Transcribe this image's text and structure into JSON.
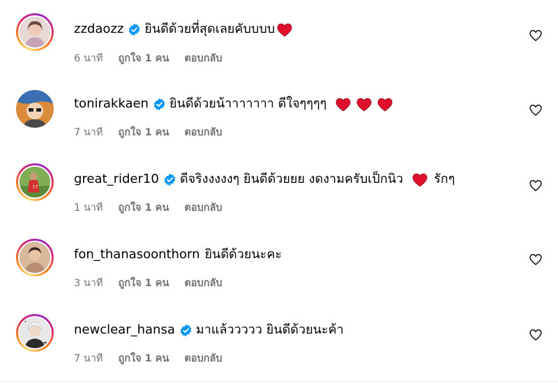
{
  "comments": [
    {
      "username": "zzdaozz",
      "verified": true,
      "text": "ยินดีด้วยที่สุดเลยคับบบบ",
      "hearts": 1,
      "time": "6 นาที",
      "likes": "ถูกใจ 1 คน",
      "reply": "ตอบกลับ"
    },
    {
      "username": "tonirakkaen",
      "verified": true,
      "text": "ยินดีด้วยน้าาาาาาา ดีใจๆๆๆๆ",
      "hearts": 3,
      "time": "7 นาที",
      "likes": "ถูกใจ 1 คน",
      "reply": "ตอบกลับ"
    },
    {
      "username": "great_rider10",
      "verified": true,
      "text": "ดีจริงงงงงๆ ยินดีด้วยยย งดงามครับเป็กนิว",
      "text_after": "รักๆ",
      "hearts": 1,
      "time": "1 นาที",
      "likes": "ถูกใจ 1 คน",
      "reply": "ตอบกลับ"
    },
    {
      "username": "fon_thanasoonthorn",
      "verified": false,
      "text": "ยินดีด้วยนะคะ",
      "hearts": 0,
      "time": "3 นาที",
      "likes": "ถูกใจ 1 คน",
      "reply": "ตอบกลับ"
    },
    {
      "username": "newclear_hansa",
      "verified": true,
      "text": "มาแล้ววววว ยินดีด้วยนะค้า",
      "hearts": 0,
      "time": "7 นาที",
      "likes": "ถูกใจ 1 คน",
      "reply": "ตอบกลับ"
    }
  ],
  "icons": {
    "verified": "verified-badge-icon",
    "heart_emoji": "red-heart-emoji-icon",
    "like": "heart-outline-icon"
  },
  "colors": {
    "verified": "#0095f6",
    "heart_emoji": "#e0102d",
    "meta_text": "#737373"
  }
}
